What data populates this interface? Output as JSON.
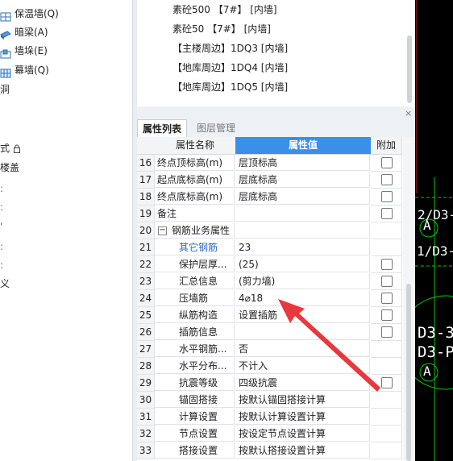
{
  "left_nav": {
    "items": [
      {
        "label": "保温墙(Q)",
        "icon": "insulation-wall-icon"
      },
      {
        "label": "暗梁(A)",
        "icon": "hidden-beam-icon"
      },
      {
        "label": "墙垛(E)",
        "icon": "wall-pier-icon"
      },
      {
        "label": "幕墙(Q)",
        "icon": "curtain-wall-icon"
      },
      {
        "label": "洞",
        "icon": ""
      },
      {
        "label": "式",
        "icon": "lock-icon"
      },
      {
        "label": "楼盖",
        "icon": ""
      },
      {
        "label": "义",
        "icon": ""
      }
    ]
  },
  "component_list": [
    "素砼500 【7#】 [内墙]",
    "素砼50 【7#】 [内墙]",
    "【主楼周边】1DQ3 [内墙]",
    "【地库周边】1DQ4 [内墙]",
    "【地库周边】1DQ5 [内墙]"
  ],
  "panel": {
    "close_glyph": "×"
  },
  "tabs": {
    "properties": "属性列表",
    "layers": "图层管理"
  },
  "table": {
    "headers": {
      "name": "属性名称",
      "value": "属性值",
      "extra": "附加"
    },
    "rows": [
      {
        "idx": "16",
        "name": "终点顶标高(m)",
        "value": "层顶标高",
        "checkbox": true,
        "style": "plain"
      },
      {
        "idx": "17",
        "name": "起点底标高(m)",
        "value": "层底标高",
        "checkbox": true,
        "style": "plain"
      },
      {
        "idx": "18",
        "name": "终点底标高(m)",
        "value": "层底标高",
        "checkbox": true,
        "style": "plain"
      },
      {
        "idx": "19",
        "name": "备注",
        "value": "",
        "checkbox": true,
        "style": "plain"
      },
      {
        "idx": "20",
        "name": "钢筋业务属性",
        "value": "",
        "checkbox": false,
        "style": "group"
      },
      {
        "idx": "21",
        "name": "其它钢筋",
        "value": "23",
        "checkbox": false,
        "style": "blue"
      },
      {
        "idx": "22",
        "name": "保护层厚...",
        "value": "(25)",
        "checkbox": true,
        "style": "indent"
      },
      {
        "idx": "23",
        "name": "汇总信息",
        "value": "(剪力墙)",
        "checkbox": true,
        "style": "indent"
      },
      {
        "idx": "24",
        "name": "压墙筋",
        "value": "4⌀18",
        "checkbox": true,
        "style": "indent"
      },
      {
        "idx": "25",
        "name": "纵筋构造",
        "value": "设置插筋",
        "checkbox": true,
        "style": "indent"
      },
      {
        "idx": "26",
        "name": "插筋信息",
        "value": "",
        "checkbox": true,
        "style": "indent"
      },
      {
        "idx": "27",
        "name": "水平钢筋...",
        "value": "否",
        "checkbox": false,
        "style": "indent"
      },
      {
        "idx": "28",
        "name": "水平分布...",
        "value": "不计入",
        "checkbox": false,
        "style": "indent"
      },
      {
        "idx": "29",
        "name": "抗震等级",
        "value": "四级抗震",
        "checkbox": true,
        "style": "indent"
      },
      {
        "idx": "30",
        "name": "锚固搭接",
        "value": "按默认锚固搭接计算",
        "checkbox": false,
        "style": "indent"
      },
      {
        "idx": "31",
        "name": "计算设置",
        "value": "按默认计算设置计算",
        "checkbox": false,
        "style": "indent"
      },
      {
        "idx": "32",
        "name": "节点设置",
        "value": "按设定节点设置计算",
        "checkbox": false,
        "style": "indent"
      },
      {
        "idx": "33",
        "name": "搭接设置",
        "value": "按默认搭接设置计算",
        "checkbox": false,
        "style": "indent"
      }
    ]
  },
  "cad": {
    "labels": [
      "2/D3-",
      "A",
      "1/D3-",
      "D3-3",
      "D3-P",
      "A"
    ],
    "colors": {
      "background": "#000000",
      "line": "#00c800",
      "text": "#ffffff",
      "axis": "#c81e1e"
    }
  },
  "annotation": {
    "arrow_color": "#e8383d"
  },
  "colors": {
    "header_accent": "#3b8eea",
    "link_blue": "#2667c9"
  }
}
